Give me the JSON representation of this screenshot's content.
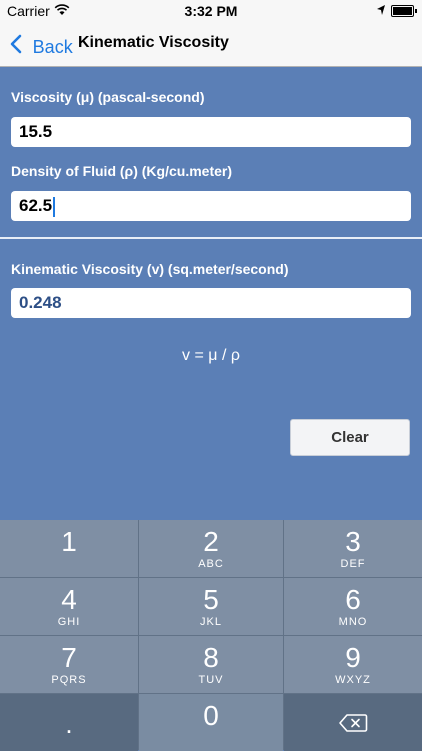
{
  "status_bar": {
    "carrier": "Carrier",
    "time": "3:32 PM"
  },
  "nav": {
    "back_label": "Back",
    "title": "Kinematic Viscosity"
  },
  "form": {
    "viscosity_label": "Viscosity (μ) (pascal-second)",
    "viscosity_value": "15.5",
    "density_label": "Density of Fluid (ρ) (Kg/cu.meter)",
    "density_value": "62.5",
    "result_label": "Kinematic Viscosity (v) (sq.meter/second)",
    "result_value": "0.248",
    "formula": "v = μ / ρ",
    "clear_label": "Clear"
  },
  "keypad": {
    "keys": [
      {
        "num": "1",
        "letters": ""
      },
      {
        "num": "2",
        "letters": "ABC"
      },
      {
        "num": "3",
        "letters": "DEF"
      },
      {
        "num": "4",
        "letters": "GHI"
      },
      {
        "num": "5",
        "letters": "JKL"
      },
      {
        "num": "6",
        "letters": "MNO"
      },
      {
        "num": "7",
        "letters": "PQRS"
      },
      {
        "num": "8",
        "letters": "TUV"
      },
      {
        "num": "9",
        "letters": "WXYZ"
      },
      {
        "num": ".",
        "letters": ""
      },
      {
        "num": "0",
        "letters": ""
      }
    ]
  },
  "icons": {
    "back": "chevron-left-icon",
    "wifi": "wifi-icon",
    "location": "location-arrow-icon",
    "battery": "battery-icon",
    "backspace": "backspace-icon"
  }
}
